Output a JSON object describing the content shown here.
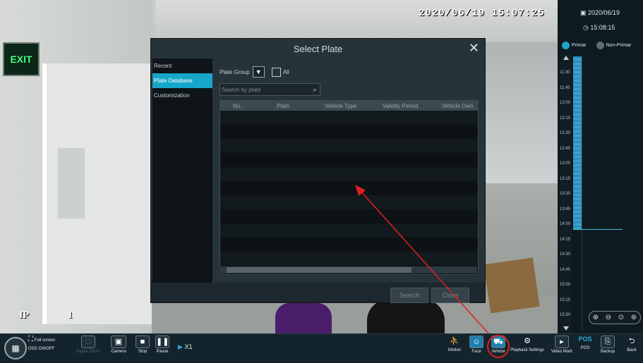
{
  "video": {
    "timestamp": "2020/06/19 15:07:25",
    "exit_sign": "EXIT",
    "channel_label": "IP",
    "channel_number": "1"
  },
  "right_panel": {
    "date": "2020/06/19",
    "time": "15:08:15",
    "mode_primary": "Primar",
    "mode_secondary": "Non-Primar",
    "ticks": [
      "11:30",
      "11:45",
      "12:00",
      "12:15",
      "12:30",
      "12:45",
      "13:00",
      "13:15",
      "13:30",
      "13:45",
      "14:00",
      "14:15",
      "14:30",
      "14:45",
      "15:00",
      "15:15",
      "15:30"
    ]
  },
  "dialog": {
    "title": "Select Plate",
    "side_items": [
      "Recent",
      "Plate Database",
      "Customization"
    ],
    "selected_item": "Plate Database",
    "plate_group_label": "Plate Group",
    "all_label": "All",
    "search_placeholder": "Search by plate",
    "columns": [
      "No.",
      "Plate",
      "Vehicle Type",
      "Validity Period",
      "Vehicle Own"
    ],
    "search_button": "Search",
    "close_button": "Close"
  },
  "toolbar": {
    "full_screen": "Full screen",
    "osd": "OSD ON/OFF",
    "digital_zoom": "Digital Zoom",
    "camera": "Camera",
    "stop": "Stop",
    "pause": "Pause",
    "speed": "X1",
    "motion": "Motion",
    "face": "Face",
    "vehicle": "Vehicle",
    "playback_settings": "Playback Settings",
    "video_mark": "Video Mark",
    "pos": "POS",
    "backup": "Backup",
    "back": "Back"
  },
  "colors": {
    "accent": "#16a6c9",
    "annotation": "#e02020"
  }
}
